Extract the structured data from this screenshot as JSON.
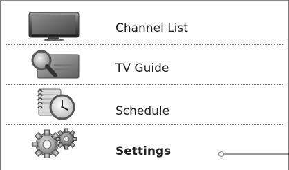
{
  "menu": {
    "items": [
      {
        "label": "Channel List",
        "icon": "tv-icon",
        "selected": false
      },
      {
        "label": "TV Guide",
        "icon": "tv-guide-icon",
        "selected": false
      },
      {
        "label": "Schedule",
        "icon": "schedule-clock-icon",
        "selected": false
      },
      {
        "label": "Settings",
        "icon": "settings-gears-icon",
        "selected": true
      }
    ]
  },
  "colors": {
    "separator": "#6b6b6b",
    "text": "#222222",
    "frame": "#7a7a7a"
  }
}
